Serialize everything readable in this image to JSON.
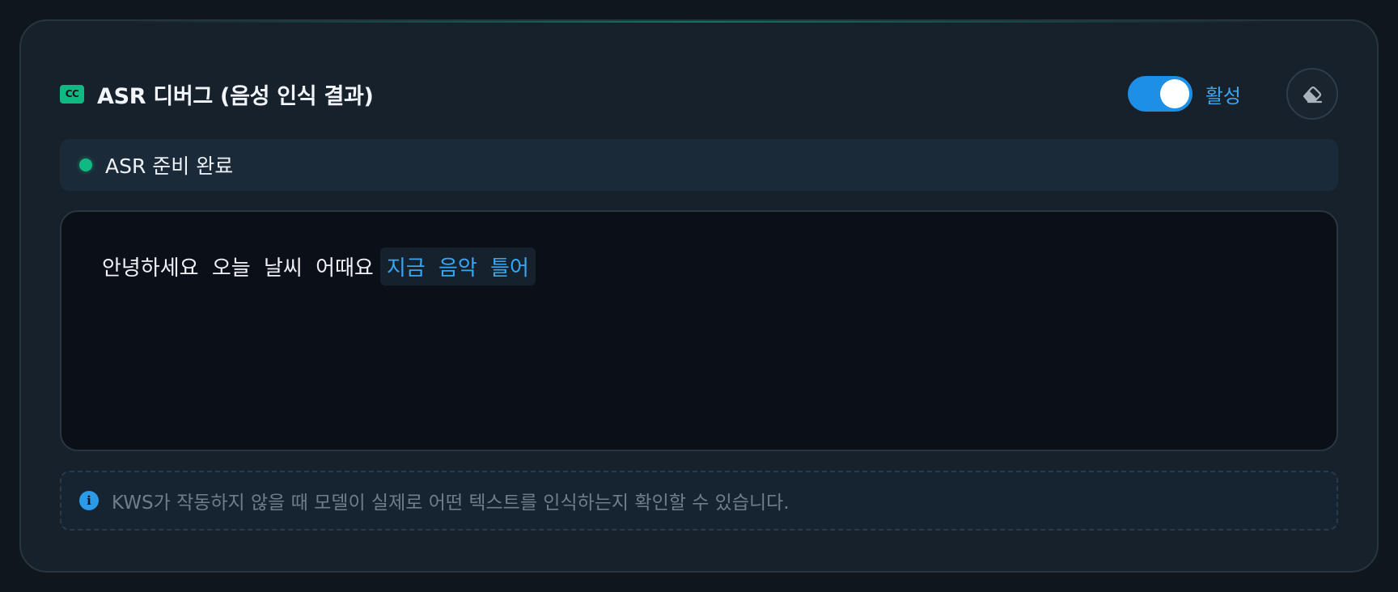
{
  "panel": {
    "badge": "CC",
    "title": "ASR 디버그 (음성 인식 결과)",
    "toggle": {
      "on": true,
      "label": "활성"
    },
    "clear_button_icon": "eraser-icon"
  },
  "status": {
    "text": "ASR 준비 완료",
    "color": "#10b981"
  },
  "transcript": {
    "final": "안녕하세요 오늘 날씨 어때요",
    "partial": "지금 음악 틀어"
  },
  "info": {
    "icon": "info-icon",
    "text": "KWS가 작동하지 않을 때 모델이 실제로 어떤 텍스트를 인식하는지 확인할 수 있습니다."
  },
  "colors": {
    "accent": "#1e8fe6",
    "success": "#10b981",
    "partial_text": "#3aa6f0"
  }
}
